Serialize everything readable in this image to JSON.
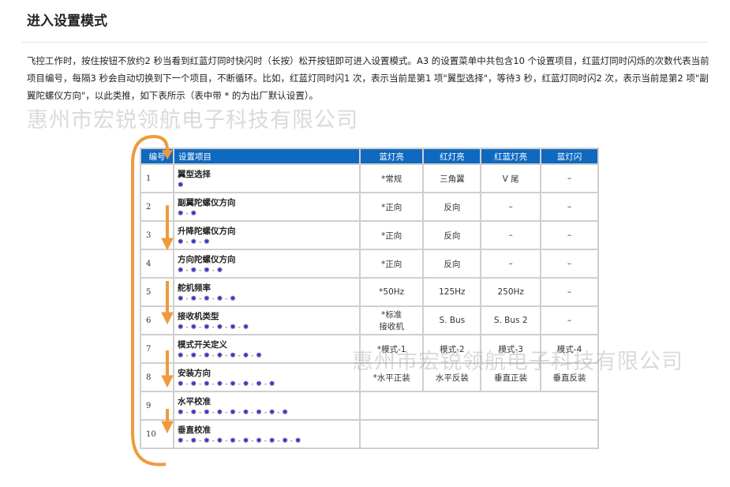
{
  "title": "进入设置模式",
  "intro": "飞控工作时，按住按钮不放约2 秒当看到红蓝灯同时快闪时（长按）松开按钮即可进入设置模式。A3 的设置菜单中共包含10 个设置项目，红蓝灯同时闪烁的次数代表当前项目编号，每隔3 秒会自动切换到下一个项目，不断循环。比如，红蓝灯同时闪1 次，表示当前是第1 项\"翼型选择\"，等待3 秒，红蓝灯同时闪2 次，表示当前是第2 项\"副翼陀螺仪方向\"，以此类推，如下表所示（表中带 * 的为出厂默认设置）。",
  "watermark": "惠州市宏锐领航电子科技有限公司",
  "table": {
    "headers": [
      "编号",
      "设置项目",
      "蓝灯亮",
      "红灯亮",
      "红蓝灯亮",
      "蓝灯闪"
    ],
    "rows": [
      {
        "num": "1",
        "name": "翼型选择",
        "blinks": "✹",
        "c1": "*常规",
        "c2": "三角翼",
        "c3": "V 尾",
        "c4": "–"
      },
      {
        "num": "2",
        "name": "副翼陀螺仪方向",
        "blinks": "✹ - ✹",
        "c1": "*正向",
        "c2": "反向",
        "c3": "–",
        "c4": "–"
      },
      {
        "num": "3",
        "name": "升降陀螺仪方向",
        "blinks": "✹ - ✹ - ✹",
        "c1": "*正向",
        "c2": "反向",
        "c3": "–",
        "c4": "–"
      },
      {
        "num": "4",
        "name": "方向陀螺仪方向",
        "blinks": "✹ - ✹ - ✹ - ✹",
        "c1": "*正向",
        "c2": "反向",
        "c3": "–",
        "c4": "–"
      },
      {
        "num": "5",
        "name": "舵机频率",
        "blinks": "✹ - ✹ - ✹ - ✹ - ✹",
        "c1": "*50Hz",
        "c2": "125Hz",
        "c3": "250Hz",
        "c4": "–"
      },
      {
        "num": "6",
        "name": "接收机类型",
        "blinks": "✹ - ✹ - ✹ - ✹ - ✹ - ✹",
        "c1": "*标准\n接收机",
        "c2": "S. Bus",
        "c3": "S. Bus  2",
        "c4": "–"
      },
      {
        "num": "7",
        "name": "模式开关定义",
        "blinks": "✹ - ✹ - ✹ - ✹ - ✹ - ✹ - ✹",
        "c1": "*模式-1",
        "c2": "模式-2",
        "c3": "模式-3",
        "c4": "模式-4"
      },
      {
        "num": "8",
        "name": "安装方向",
        "blinks": "✹ - ✹ - ✹ - ✹ - ✹ - ✹ - ✹ - ✹",
        "c1": "*水平正装",
        "c2": "水平反装",
        "c3": "垂直正装",
        "c4": "垂直反装"
      },
      {
        "num": "9",
        "name": "水平校准",
        "blinks": "✹ - ✹ - ✹ - ✹ - ✹ - ✹ - ✹ - ✹ - ✹",
        "c1": "",
        "c2": "",
        "c3": "",
        "c4": ""
      },
      {
        "num": "10",
        "name": "垂直校准",
        "blinks": "✹ - ✹ - ✹ - ✹ - ✹ - ✹ - ✹ - ✹ - ✹ - ✹",
        "c1": "",
        "c2": "",
        "c3": "",
        "c4": ""
      }
    ]
  },
  "colors": {
    "header_bg": "#0f69bf",
    "arrow": "#ef9a3c",
    "blink_red": "#d4204a",
    "blink_blue": "#2a43c8"
  }
}
